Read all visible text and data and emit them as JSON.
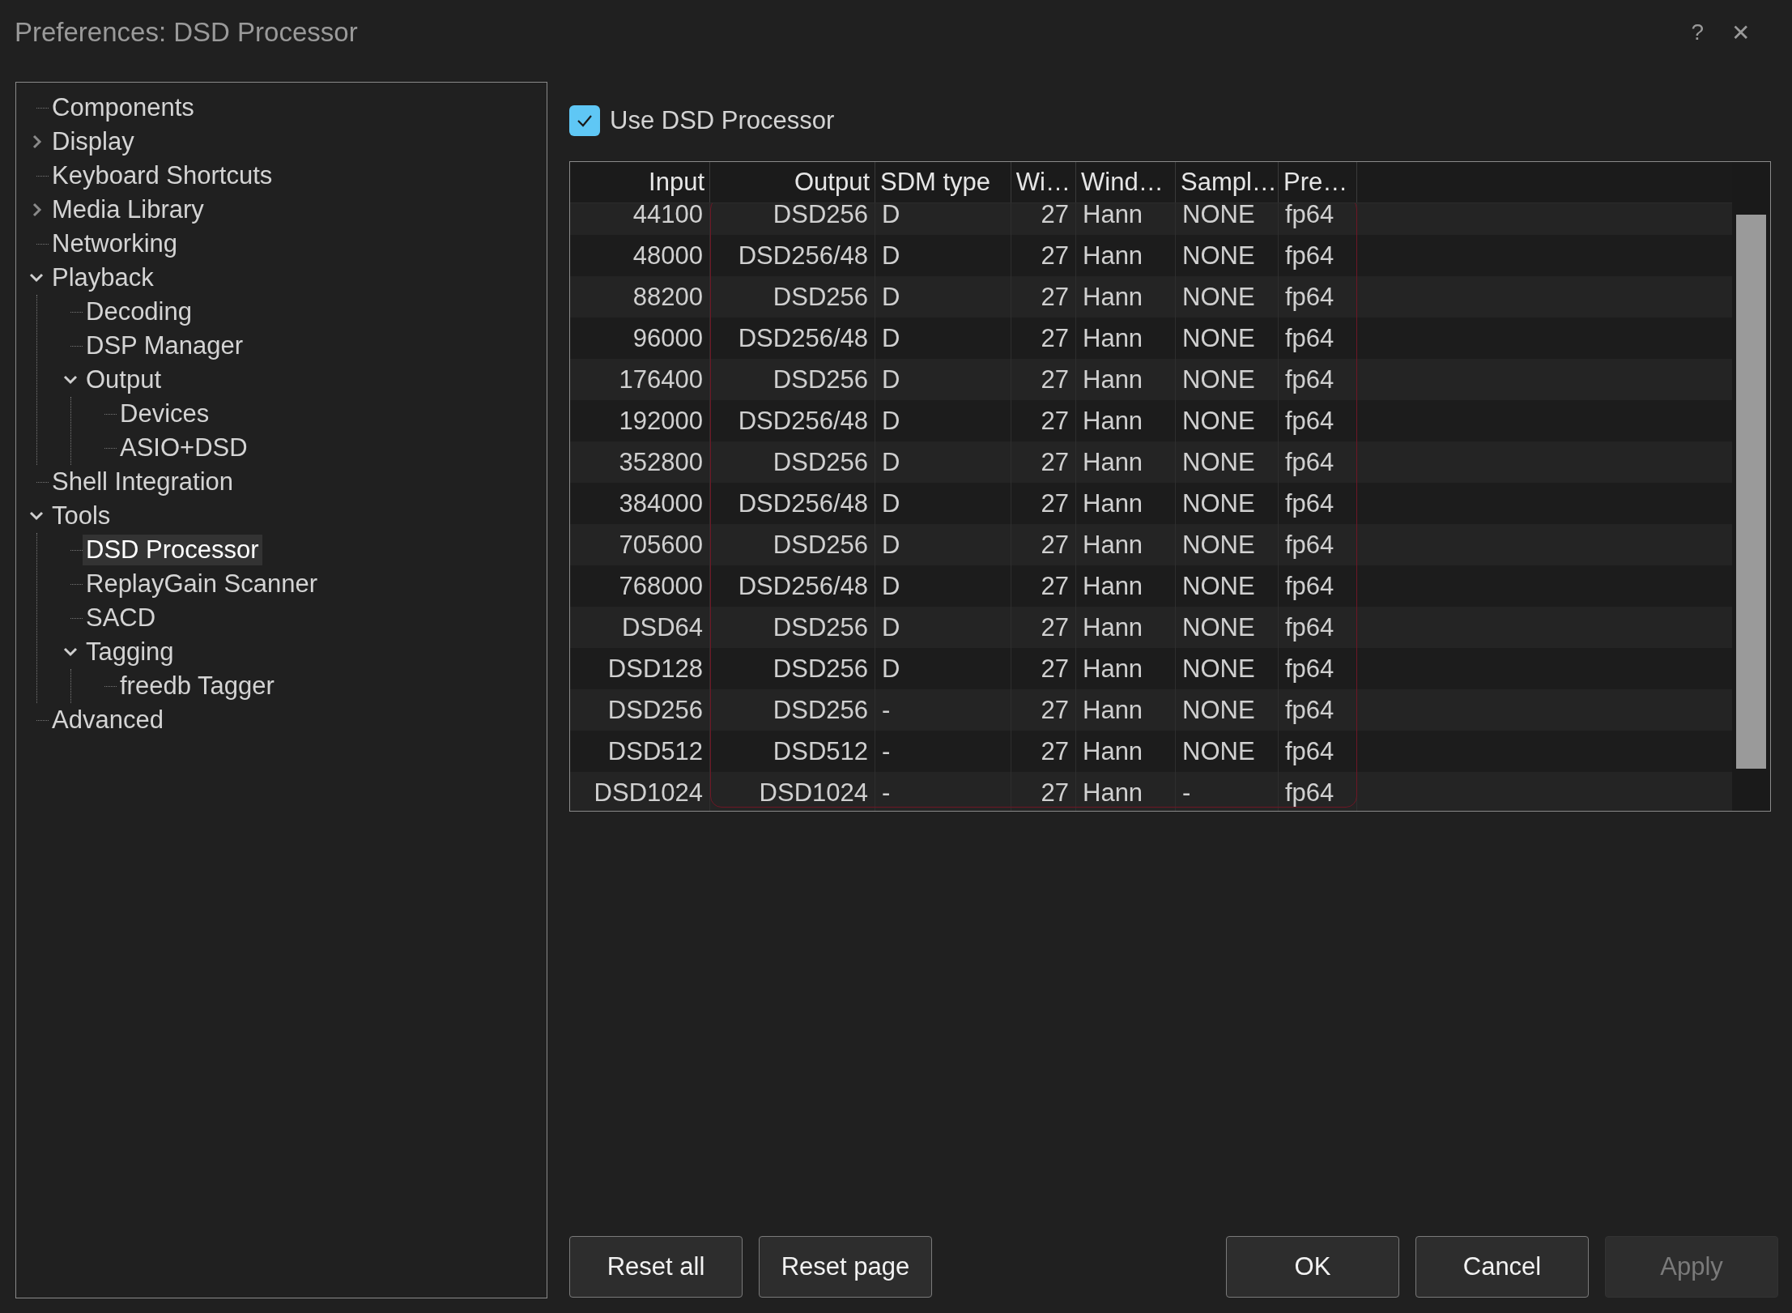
{
  "window": {
    "title": "Preferences: DSD Processor",
    "help": "?",
    "close": "✕"
  },
  "tree": [
    {
      "label": "Components",
      "kind": "leaf",
      "selected": false
    },
    {
      "label": "Display",
      "kind": "folder",
      "expanded": false,
      "selected": false
    },
    {
      "label": "Keyboard Shortcuts",
      "kind": "leaf",
      "selected": false
    },
    {
      "label": "Media Library",
      "kind": "folder",
      "expanded": false,
      "selected": false
    },
    {
      "label": "Networking",
      "kind": "leaf",
      "selected": false
    },
    {
      "label": "Playback",
      "kind": "folder",
      "expanded": true,
      "selected": false,
      "children": [
        {
          "label": "Decoding",
          "kind": "leaf",
          "selected": false
        },
        {
          "label": "DSP Manager",
          "kind": "leaf",
          "selected": false
        },
        {
          "label": "Output",
          "kind": "folder",
          "expanded": true,
          "selected": false,
          "children": [
            {
              "label": "Devices",
              "kind": "leaf",
              "selected": false
            },
            {
              "label": "ASIO+DSD",
              "kind": "leaf",
              "selected": false
            }
          ]
        }
      ]
    },
    {
      "label": "Shell Integration",
      "kind": "leaf",
      "selected": false
    },
    {
      "label": "Tools",
      "kind": "folder",
      "expanded": true,
      "selected": false,
      "children": [
        {
          "label": "DSD Processor",
          "kind": "leaf",
          "selected": true
        },
        {
          "label": "ReplayGain Scanner",
          "kind": "leaf",
          "selected": false
        },
        {
          "label": "SACD",
          "kind": "leaf",
          "selected": false
        },
        {
          "label": "Tagging",
          "kind": "folder",
          "expanded": true,
          "selected": false,
          "children": [
            {
              "label": "freedb Tagger",
              "kind": "leaf",
              "selected": false
            }
          ]
        }
      ]
    },
    {
      "label": "Advanced",
      "kind": "leaf",
      "selected": false
    }
  ],
  "use_dsd_processor": {
    "label": "Use DSD Processor",
    "checked": true
  },
  "table": {
    "columns": [
      "Input",
      "Output",
      "SDM type",
      "Wi…",
      "Wind…",
      "Sampl…",
      "Pre…"
    ],
    "rows": [
      [
        "44100",
        "DSD256",
        "D",
        "27",
        "Hann",
        "NONE",
        "fp64"
      ],
      [
        "48000",
        "DSD256/48",
        "D",
        "27",
        "Hann",
        "NONE",
        "fp64"
      ],
      [
        "88200",
        "DSD256",
        "D",
        "27",
        "Hann",
        "NONE",
        "fp64"
      ],
      [
        "96000",
        "DSD256/48",
        "D",
        "27",
        "Hann",
        "NONE",
        "fp64"
      ],
      [
        "176400",
        "DSD256",
        "D",
        "27",
        "Hann",
        "NONE",
        "fp64"
      ],
      [
        "192000",
        "DSD256/48",
        "D",
        "27",
        "Hann",
        "NONE",
        "fp64"
      ],
      [
        "352800",
        "DSD256",
        "D",
        "27",
        "Hann",
        "NONE",
        "fp64"
      ],
      [
        "384000",
        "DSD256/48",
        "D",
        "27",
        "Hann",
        "NONE",
        "fp64"
      ],
      [
        "705600",
        "DSD256",
        "D",
        "27",
        "Hann",
        "NONE",
        "fp64"
      ],
      [
        "768000",
        "DSD256/48",
        "D",
        "27",
        "Hann",
        "NONE",
        "fp64"
      ],
      [
        "DSD64",
        "DSD256",
        "D",
        "27",
        "Hann",
        "NONE",
        "fp64"
      ],
      [
        "DSD128",
        "DSD256",
        "D",
        "27",
        "Hann",
        "NONE",
        "fp64"
      ],
      [
        "DSD256",
        "DSD256",
        "-",
        "27",
        "Hann",
        "NONE",
        "fp64"
      ],
      [
        "DSD512",
        "DSD512",
        "-",
        "27",
        "Hann",
        "NONE",
        "fp64"
      ],
      [
        "DSD1024",
        "DSD1024",
        "-",
        "27",
        "Hann",
        "-",
        "fp64"
      ]
    ]
  },
  "buttons_left": [
    {
      "label": "Reset all",
      "disabled": false
    },
    {
      "label": "Reset page",
      "disabled": false
    }
  ],
  "buttons_right": [
    {
      "label": "OK",
      "disabled": false
    },
    {
      "label": "Cancel",
      "disabled": false
    },
    {
      "label": "Apply",
      "disabled": true
    }
  ]
}
